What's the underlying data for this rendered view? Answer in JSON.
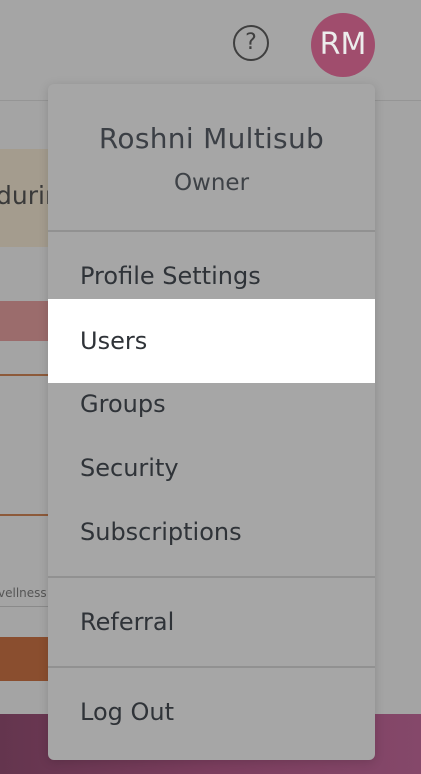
{
  "header": {
    "help_glyph": "?",
    "avatar_initials": "RM",
    "avatar_color": "#a04d6d"
  },
  "background": {
    "card_partial_text": "durin",
    "small_partial_text": "vellness"
  },
  "dropdown": {
    "user_name": "Roshni Multisub",
    "user_role": "Owner",
    "items": [
      {
        "label": "Profile Settings",
        "active": false
      },
      {
        "label": "Users",
        "active": true
      },
      {
        "label": "Groups",
        "active": false
      },
      {
        "label": "Security",
        "active": false
      },
      {
        "label": "Subscriptions",
        "active": false
      },
      {
        "label": "Referral",
        "active": false
      },
      {
        "label": "Log Out",
        "active": false
      }
    ]
  }
}
